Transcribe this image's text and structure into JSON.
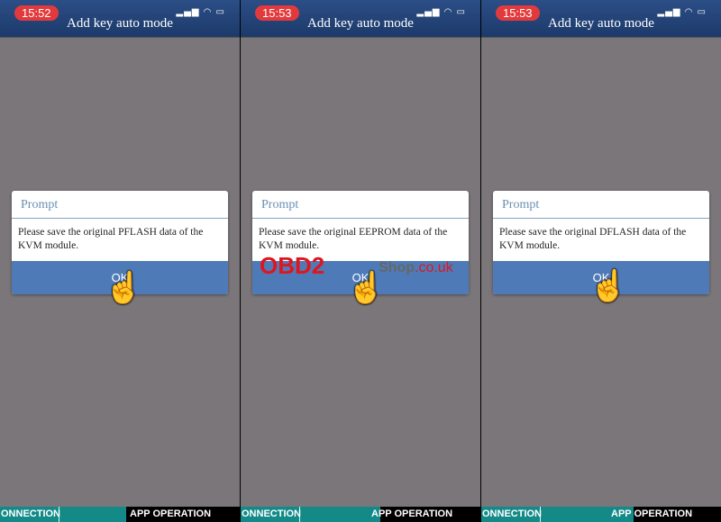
{
  "panels": [
    {
      "time": "15:52",
      "title": "Add key auto mode",
      "prompt_title": "Prompt",
      "message": "Please save the original PFLASH data of the KVM module.",
      "button": "OK",
      "footer_left": "ONNECTION",
      "footer_right": "APP OPERATION"
    },
    {
      "time": "15:53",
      "title": "Add key auto mode",
      "prompt_title": "Prompt",
      "message": "Please save the original EEPROM data of the KVM module.",
      "button": "OK",
      "footer_left": "ONNECTION",
      "footer_right": "APP OPERATION"
    },
    {
      "time": "15:53",
      "title": "Add key auto mode",
      "prompt_title": "Prompt",
      "message": "Please save the original DFLASH data of the KVM module.",
      "button": "OK",
      "footer_left": "ONNECTION",
      "footer_right": "APP OPERATION"
    }
  ],
  "status_icons": [
    "signal-icon",
    "wifi-icon",
    "battery-charging-icon"
  ],
  "watermark": {
    "brand": "OBD2",
    "shop": "Shop",
    "domain": ".co.uk"
  },
  "colors": {
    "header": "#1c3a6a",
    "button": "#4e7bb8",
    "time_badge": "#e23a3c",
    "footer": "#138a88"
  }
}
